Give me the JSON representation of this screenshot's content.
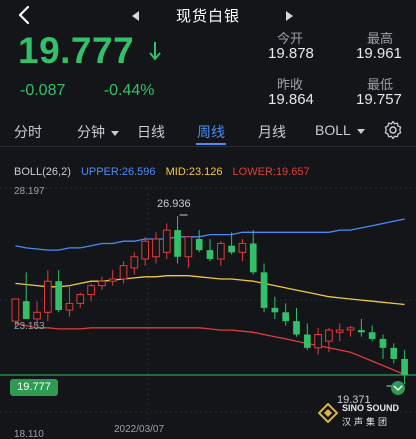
{
  "header": {
    "title": "现货白银"
  },
  "quote": {
    "price": "19.777",
    "change": "-0.087",
    "change_pct": "-0.44%",
    "stats": {
      "open_label": "今开",
      "open_value": "19.878",
      "high_label": "最高",
      "high_value": "19.961",
      "prev_close_label": "昨收",
      "prev_close_value": "19.864",
      "low_label": "最低",
      "low_value": "19.757"
    }
  },
  "tabs": [
    {
      "label": "分时"
    },
    {
      "label": "分钟"
    },
    {
      "label": "日线"
    },
    {
      "label": "周线"
    },
    {
      "label": "月线"
    },
    {
      "label": "BOLL"
    }
  ],
  "boll_legend": {
    "params": "BOLL(26,2)",
    "upper": "UPPER:26.596",
    "mid": "MID:23.126",
    "lower": "LOWER:19.657"
  },
  "chart_labels": {
    "y_top": "28.197",
    "y_mid": "23.153",
    "y_bottom": "18.110",
    "x_date": "2022/03/07",
    "high_marker": "26.936",
    "low_marker": "19.371",
    "current_price": "19.777"
  },
  "logo": {
    "text": "SINO SOUND",
    "sub": "汉声集团"
  },
  "colors": {
    "up": "#33c06a",
    "down": "#e03c3c",
    "upper": "#4c8bf5",
    "mid": "#f5c842",
    "lower": "#e03c3c",
    "active_tab": "#4c8bf5"
  },
  "chart_data": {
    "type": "candlestick",
    "ylim": [
      18.11,
      28.197
    ],
    "candles": [
      {
        "o": 22.2,
        "h": 22.8,
        "l": 21.9,
        "c": 23.2
      },
      {
        "o": 23.1,
        "h": 24.4,
        "l": 22.5,
        "c": 22.3
      },
      {
        "o": 22.3,
        "h": 23.1,
        "l": 22.0,
        "c": 22.6
      },
      {
        "o": 22.6,
        "h": 24.5,
        "l": 22.2,
        "c": 24.0
      },
      {
        "o": 24.0,
        "h": 24.5,
        "l": 22.6,
        "c": 22.7
      },
      {
        "o": 22.7,
        "h": 23.8,
        "l": 22.4,
        "c": 23.0
      },
      {
        "o": 23.0,
        "h": 23.5,
        "l": 22.8,
        "c": 23.4
      },
      {
        "o": 23.4,
        "h": 23.9,
        "l": 23.1,
        "c": 23.8
      },
      {
        "o": 23.8,
        "h": 24.2,
        "l": 23.6,
        "c": 24.0
      },
      {
        "o": 24.0,
        "h": 24.5,
        "l": 23.8,
        "c": 24.1
      },
      {
        "o": 24.1,
        "h": 24.9,
        "l": 23.9,
        "c": 24.7
      },
      {
        "o": 24.6,
        "h": 25.3,
        "l": 24.3,
        "c": 25.1
      },
      {
        "o": 25.0,
        "h": 26.0,
        "l": 24.7,
        "c": 25.8
      },
      {
        "o": 25.1,
        "h": 26.2,
        "l": 24.8,
        "c": 25.9
      },
      {
        "o": 25.3,
        "h": 26.6,
        "l": 25.0,
        "c": 26.3
      },
      {
        "o": 26.3,
        "h": 26.936,
        "l": 24.8,
        "c": 25.1
      },
      {
        "o": 25.1,
        "h": 26.0,
        "l": 24.6,
        "c": 26.0
      },
      {
        "o": 25.9,
        "h": 26.3,
        "l": 25.3,
        "c": 25.4
      },
      {
        "o": 25.4,
        "h": 25.9,
        "l": 24.9,
        "c": 25.0
      },
      {
        "o": 25.0,
        "h": 25.8,
        "l": 24.7,
        "c": 25.7
      },
      {
        "o": 25.6,
        "h": 26.2,
        "l": 25.2,
        "c": 25.3
      },
      {
        "o": 25.3,
        "h": 25.9,
        "l": 24.9,
        "c": 25.7
      },
      {
        "o": 25.7,
        "h": 26.3,
        "l": 24.3,
        "c": 24.4
      },
      {
        "o": 24.4,
        "h": 24.8,
        "l": 22.6,
        "c": 22.8
      },
      {
        "o": 22.8,
        "h": 23.3,
        "l": 22.3,
        "c": 22.6
      },
      {
        "o": 22.6,
        "h": 23.0,
        "l": 22.0,
        "c": 22.2
      },
      {
        "o": 22.2,
        "h": 22.8,
        "l": 21.5,
        "c": 21.6
      },
      {
        "o": 21.6,
        "h": 22.1,
        "l": 20.9,
        "c": 21.0
      },
      {
        "o": 21.0,
        "h": 21.9,
        "l": 20.7,
        "c": 21.6
      },
      {
        "o": 21.3,
        "h": 21.9,
        "l": 20.8,
        "c": 21.8
      },
      {
        "o": 21.7,
        "h": 22.1,
        "l": 21.3,
        "c": 21.8
      },
      {
        "o": 21.8,
        "h": 22.0,
        "l": 21.5,
        "c": 21.9
      },
      {
        "o": 21.8,
        "h": 22.3,
        "l": 21.5,
        "c": 21.7
      },
      {
        "o": 21.7,
        "h": 22.0,
        "l": 21.3,
        "c": 21.4
      },
      {
        "o": 21.4,
        "h": 21.6,
        "l": 20.5,
        "c": 21.0
      },
      {
        "o": 21.0,
        "h": 21.2,
        "l": 20.3,
        "c": 20.5
      },
      {
        "o": 20.5,
        "h": 20.9,
        "l": 19.371,
        "c": 19.777
      }
    ],
    "upper": [
      25.6,
      25.5,
      25.45,
      25.4,
      25.4,
      25.5,
      25.5,
      25.6,
      25.7,
      25.7,
      25.8,
      25.8,
      25.9,
      25.9,
      25.9,
      26.0,
      26.0,
      26.0,
      26.1,
      26.1,
      26.1,
      26.2,
      26.2,
      26.2,
      26.2,
      26.2,
      26.2,
      26.2,
      26.2,
      26.2,
      26.3,
      26.3,
      26.4,
      26.5,
      26.6,
      26.7,
      26.8
    ],
    "mid": [
      23.9,
      23.85,
      23.8,
      23.75,
      23.75,
      23.8,
      23.9,
      24.0,
      24.0,
      24.05,
      24.1,
      24.15,
      24.2,
      24.2,
      24.25,
      24.25,
      24.25,
      24.2,
      24.15,
      24.1,
      24.1,
      24.05,
      24.0,
      23.9,
      23.8,
      23.7,
      23.6,
      23.5,
      23.4,
      23.3,
      23.25,
      23.2,
      23.15,
      23.1,
      23.05,
      23.0,
      22.95
    ],
    "lower": [
      22.1,
      22.0,
      21.9,
      21.9,
      21.85,
      21.85,
      21.85,
      21.9,
      21.9,
      21.9,
      21.9,
      21.9,
      21.9,
      21.9,
      21.9,
      21.9,
      21.9,
      21.9,
      21.85,
      21.8,
      21.8,
      21.75,
      21.7,
      21.6,
      21.5,
      21.4,
      21.3,
      21.2,
      21.1,
      21.0,
      20.9,
      20.8,
      20.6,
      20.4,
      20.2,
      20.0,
      19.8
    ]
  }
}
